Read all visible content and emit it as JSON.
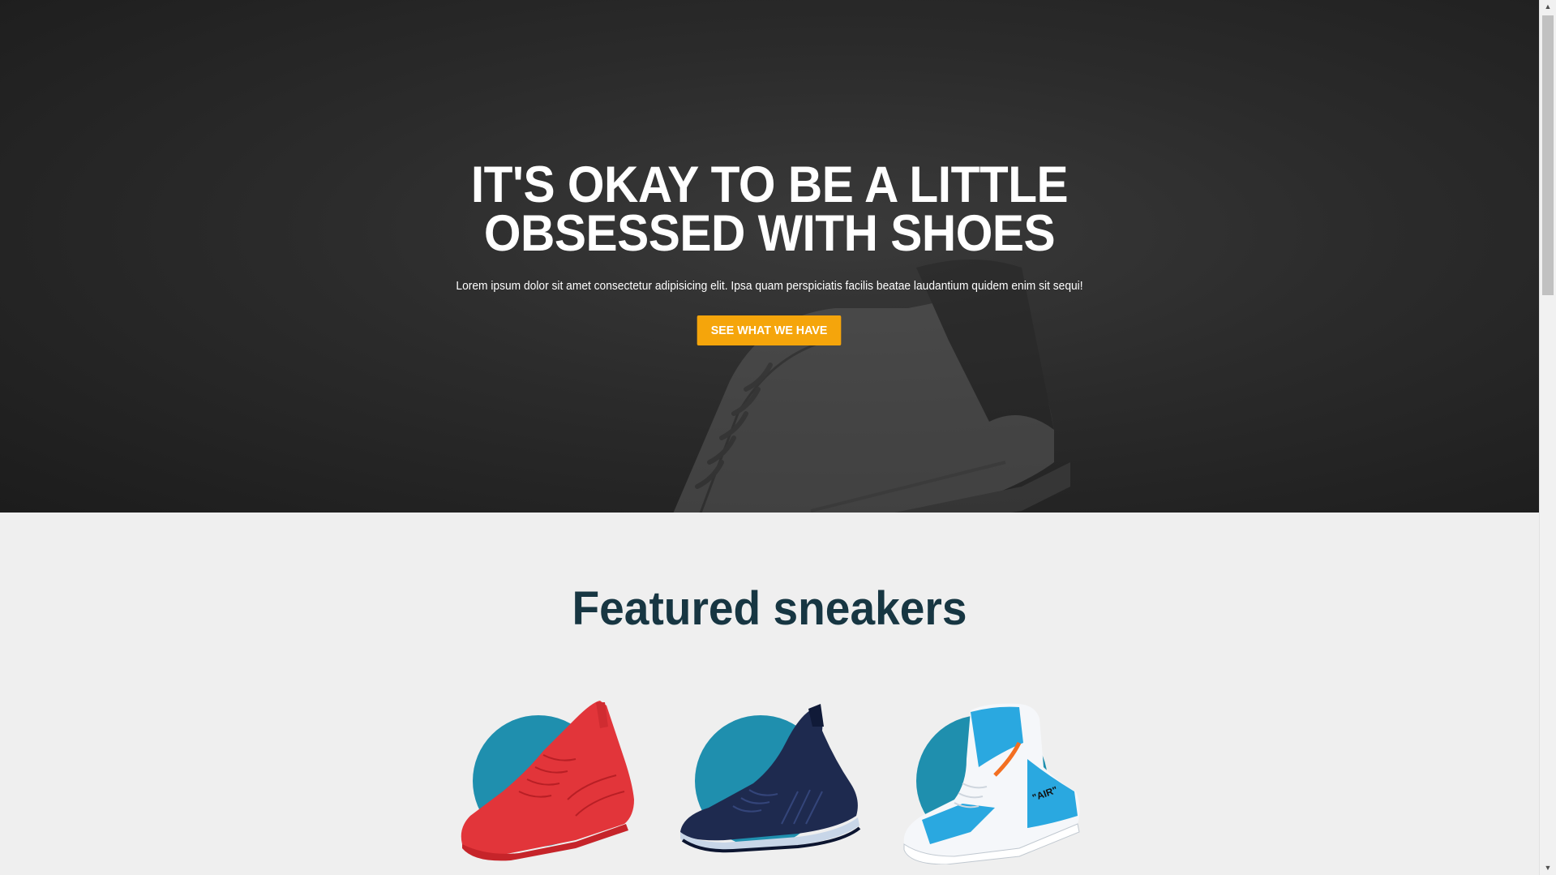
{
  "hero": {
    "title_line1": "IT'S OKAY TO BE A LITTLE",
    "title_line2": "OBSESSED WITH SHOES",
    "subtitle": "Lorem ipsum dolor sit amet consectetur adipisicing elit. Ipsa quam perspiciatis facilis beatae laudantium quidem enim sit sequi!",
    "cta_label": "SEE WHAT WE HAVE",
    "cta_color": "#f5a50b",
    "background_color": "#2b2b2b"
  },
  "featured": {
    "title": "Featured sneakers",
    "title_color": "#173642",
    "circle_color": "#1f8fae",
    "products": [
      {
        "image": "red-high-top-sneaker",
        "color": "#e2353a"
      },
      {
        "image": "navy-knit-runner-sneaker",
        "color": "#1e2a4f"
      },
      {
        "image": "blue-white-air-high-top-sneaker",
        "color": "#2aa8e0",
        "print": "\"AIR\""
      }
    ]
  },
  "scrollbar": {
    "up_icon": "triangle-up-icon",
    "down_icon": "triangle-down-icon"
  }
}
